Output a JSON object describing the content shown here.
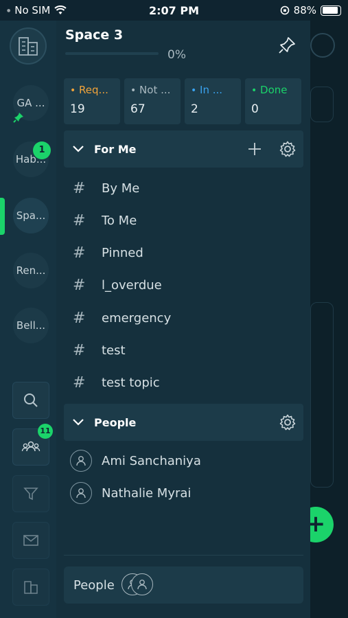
{
  "status_bar": {
    "carrier": "No SIM",
    "time": "2:07 PM",
    "battery": "88%"
  },
  "rail": {
    "spaces": [
      {
        "label": "GA ...",
        "pinned": true
      },
      {
        "label": "Hab...",
        "badge": "1"
      },
      {
        "label": "Spa...",
        "active": true
      },
      {
        "label": "Ren..."
      },
      {
        "label": "Bell..."
      }
    ],
    "people_badge": "11"
  },
  "drawer": {
    "title": "Space 3",
    "progress_percent": 0,
    "progress_text": "0%",
    "stats": [
      {
        "label": "Req...",
        "value": "19",
        "color": "#f0a33a"
      },
      {
        "label": "Not ...",
        "value": "67",
        "color": "#a9b9c0"
      },
      {
        "label": "In ...",
        "value": "2",
        "color": "#3aa3f0"
      },
      {
        "label": "Done",
        "value": "0",
        "color": "#1bd36a"
      }
    ],
    "for_me": {
      "title": "For Me",
      "topics": [
        "By Me",
        "To Me",
        "Pinned",
        "l_overdue",
        "emergency",
        "test",
        "test topic"
      ]
    },
    "people": {
      "title": "People",
      "members": [
        "Ami Sanchaniya",
        "Nathalie Myrai"
      ]
    },
    "footer": {
      "label": "People"
    }
  },
  "colors": {
    "accent": "#1bd36a",
    "rail_bg": "#163341",
    "drawer_bg": "#15303d"
  }
}
